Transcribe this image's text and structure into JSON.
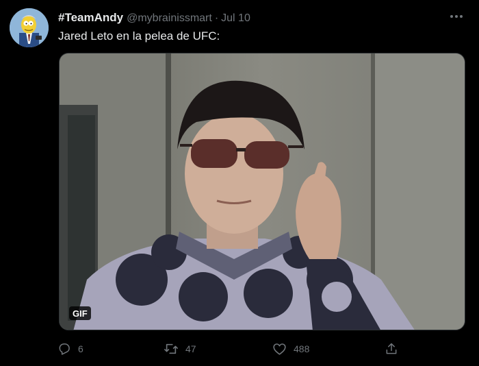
{
  "tweet": {
    "display_name": "#TeamAndy",
    "handle": "@mybrainissmart",
    "separator": "·",
    "date": "Jul 10",
    "text": "Jared Leto en la pelea de UFC:",
    "media": {
      "badge": "GIF"
    }
  },
  "actions": {
    "reply_count": "6",
    "retweet_count": "47",
    "like_count": "488"
  },
  "icons": {
    "avatar": "cartoon-avatar",
    "more": "more-horizontal-icon",
    "reply": "reply-icon",
    "retweet": "retweet-icon",
    "like": "heart-icon",
    "share": "share-icon"
  },
  "colors": {
    "background": "#000000",
    "text_primary": "#e7e9ea",
    "text_secondary": "#71767b"
  }
}
